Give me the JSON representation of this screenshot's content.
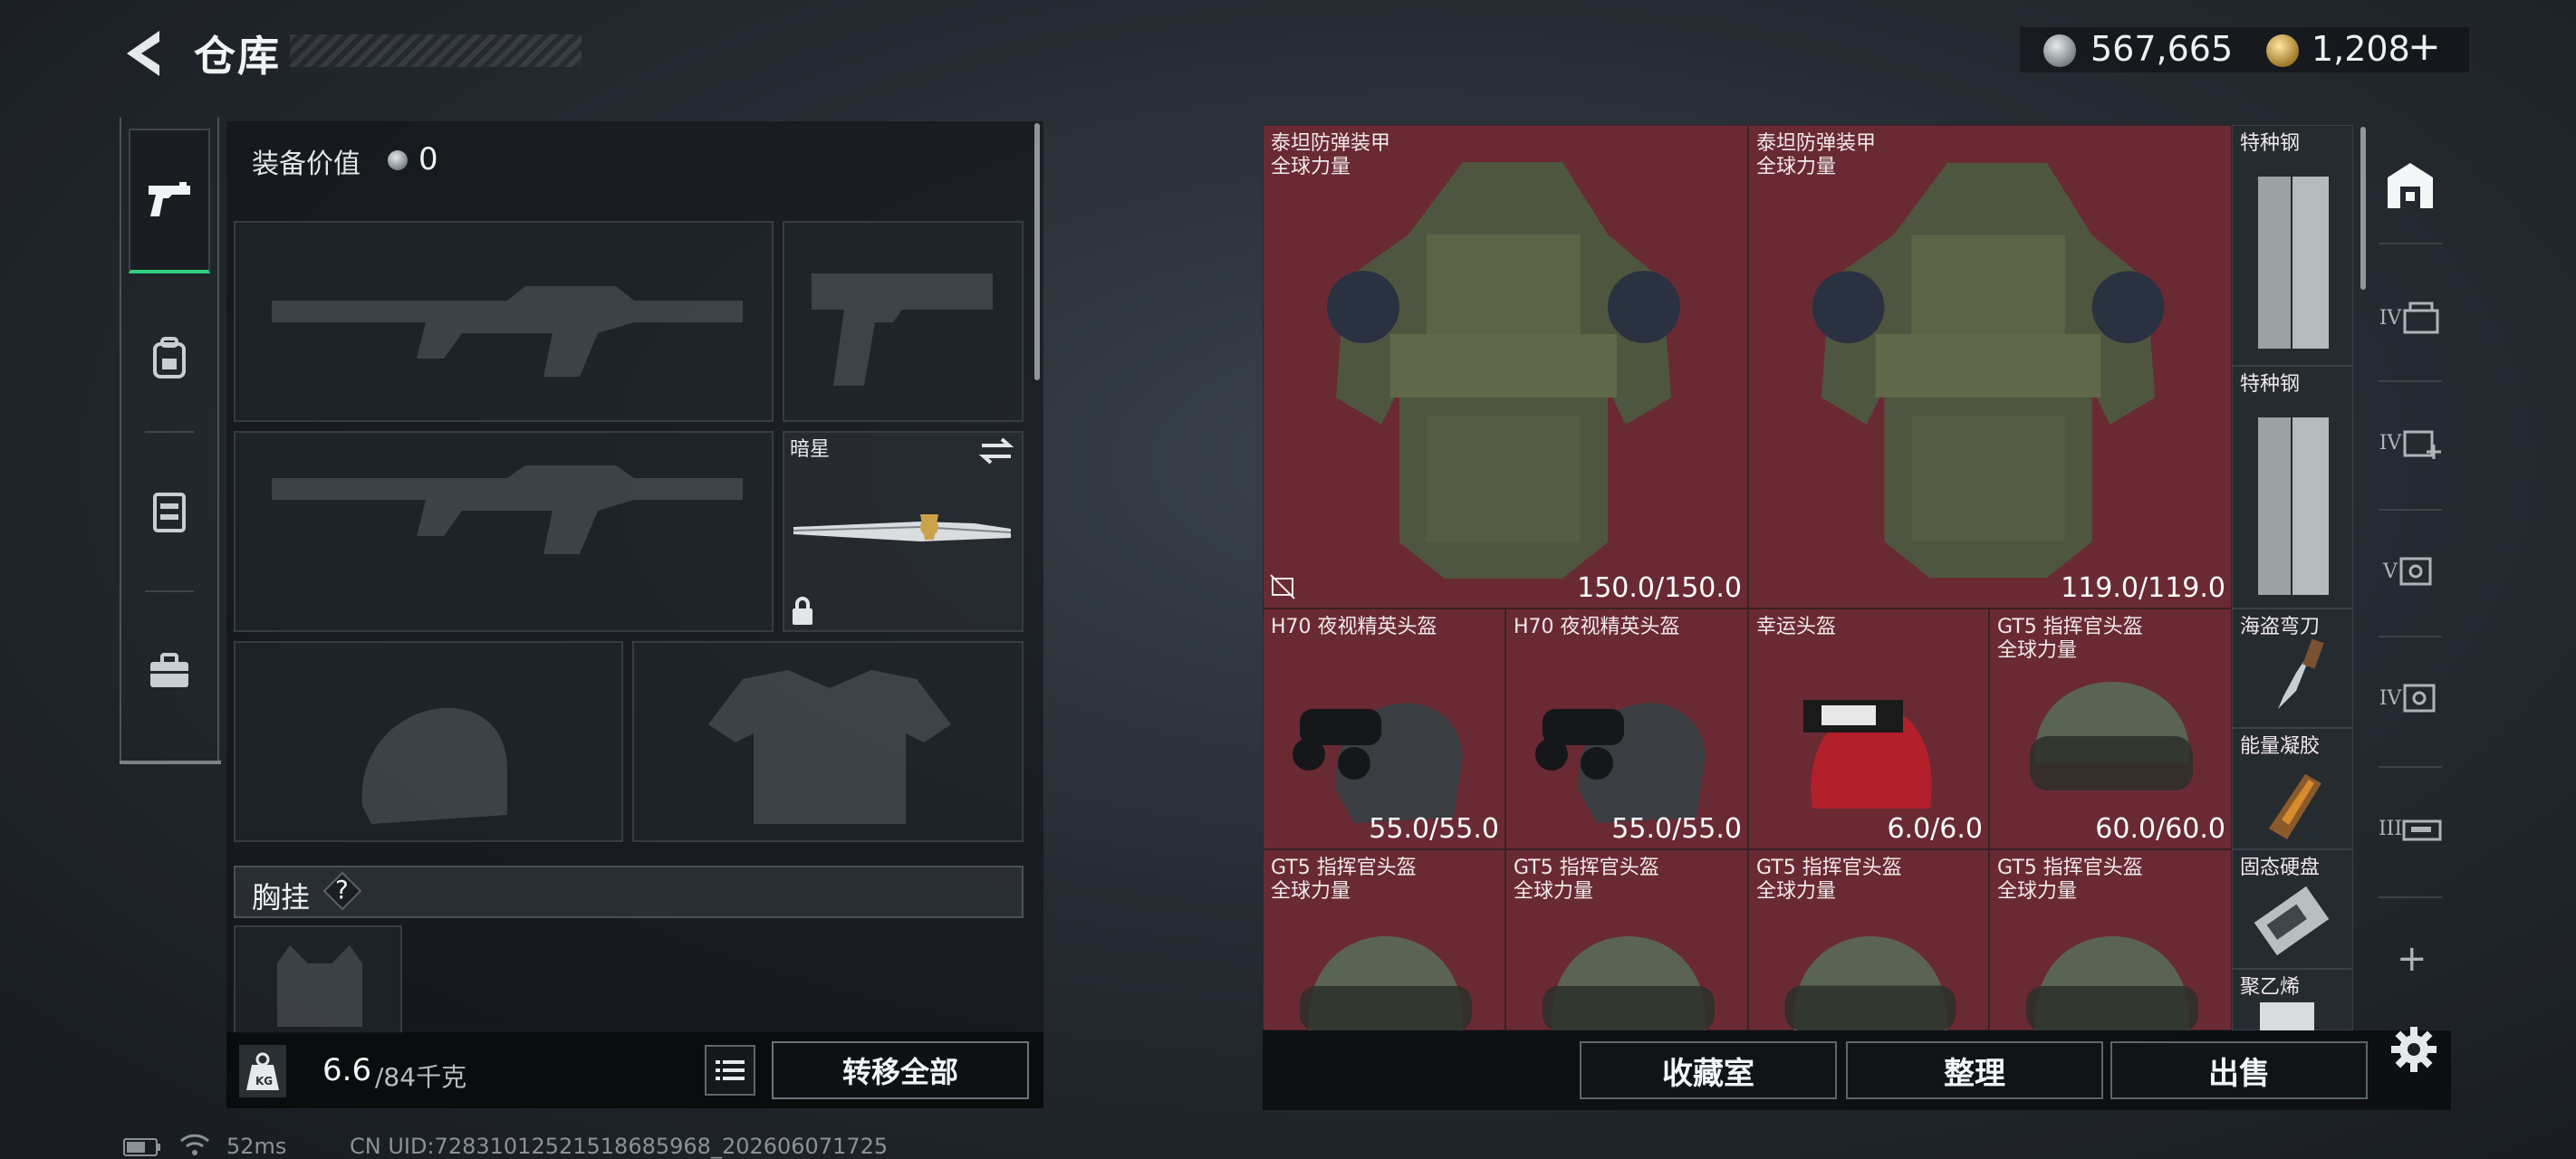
{
  "header": {
    "title": "仓库"
  },
  "currency": [
    {
      "value": "567,665",
      "color": "#c8cdd1"
    },
    {
      "value": "1,208",
      "color": "#d9b45a",
      "plus": "+"
    }
  ],
  "loadout": {
    "equip_value_label": "装备价值",
    "equip_value": "0",
    "melee_name": "暗星",
    "chest_rig_label": "胸挂",
    "chest_rig_help": "?"
  },
  "footer_left": {
    "weight_current": "6.6",
    "weight_max": "/84千克",
    "transfer_all": "转移全部",
    "ping": "52ms",
    "uid": "CN UID:7283101252151868​5968_202606071725"
  },
  "stash_items": [
    {
      "name": "泰坦防弹装甲",
      "sub": "全球力量",
      "durability": "150.0/150.0",
      "type": "armor"
    },
    {
      "name": "泰坦防弹装甲",
      "sub": "全球力量",
      "durability": "119.0/119.0",
      "type": "armor"
    },
    {
      "name": "特种钢",
      "type": "steel"
    },
    {
      "name": "特种钢",
      "type": "steel"
    },
    {
      "name": "H70 夜视精英头盔",
      "durability": "55.0/55.0",
      "type": "nvg-helmet"
    },
    {
      "name": "H70 夜视精英头盔",
      "durability": "55.0/55.0",
      "type": "nvg-helmet"
    },
    {
      "name": "幸运头盔",
      "durability": "6.0/6.0",
      "type": "red-helmet"
    },
    {
      "name": "GT5 指挥官头盔",
      "sub": "全球力量",
      "durability": "60.0/60.0",
      "type": "gt5-helmet"
    },
    {
      "name": "海盗弯刀",
      "type": "knife"
    },
    {
      "name": "能量凝胶",
      "type": "gel"
    },
    {
      "name": "GT5 指挥官头盔",
      "sub": "全球力量",
      "type": "gt5-helmet"
    },
    {
      "name": "GT5 指挥官头盔",
      "sub": "全球力量",
      "type": "gt5-helmet"
    },
    {
      "name": "GT5 指挥官头盔",
      "sub": "全球力量",
      "type": "gt5-helmet"
    },
    {
      "name": "GT5 指挥官头盔",
      "sub": "全球力量",
      "type": "gt5-helmet"
    },
    {
      "name": "固态硬盘",
      "type": "ssd"
    },
    {
      "name": "聚乙烯",
      "type": "poly"
    }
  ],
  "stash_actions": {
    "collection": "收藏室",
    "sort": "整理",
    "sell": "出售"
  },
  "page_tabs": [
    "IV",
    "IV",
    "V",
    "IV",
    "III"
  ],
  "add_page": "+",
  "colors": {
    "accent_green": "#2fd17e",
    "item_red": "#6a2a33",
    "panel": "#14181b"
  }
}
